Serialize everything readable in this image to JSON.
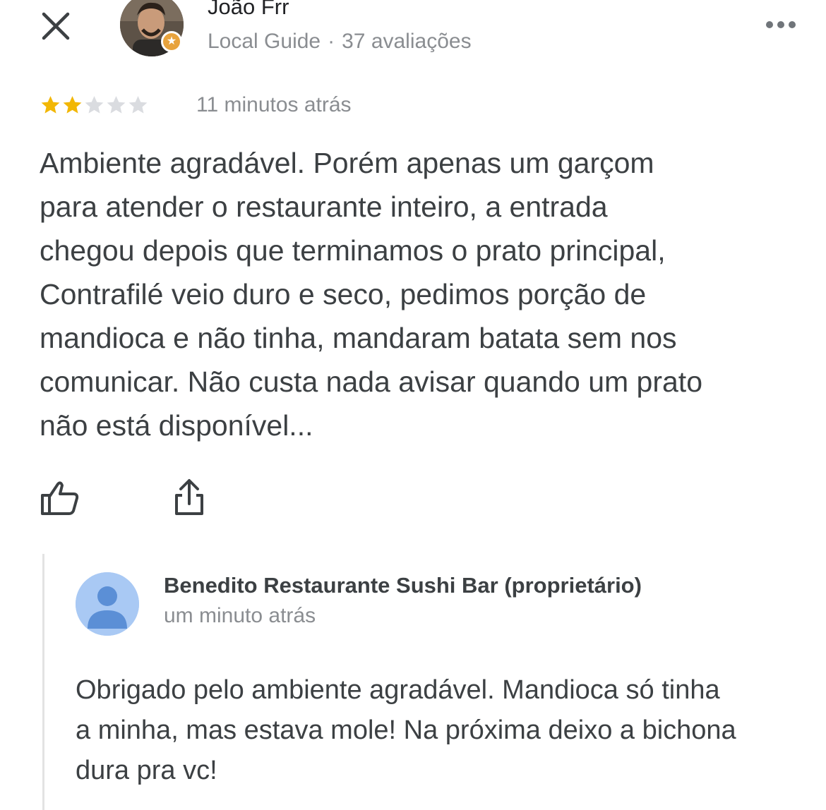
{
  "review": {
    "author": {
      "name": "João Frr",
      "badge": "Local Guide",
      "separator": "·",
      "review_count_label": "37 avaliações"
    },
    "rating": {
      "value": 2,
      "max": 5,
      "filled_color": "#f2b705",
      "empty_color": "#dadce0"
    },
    "time": "11 minutos atrás",
    "text_lines": [
      "Ambiente agradável. Porém apenas um garçom",
      "para atender o restaurante inteiro, a entrada",
      "chegou depois que terminamos o prato principal,",
      "Contrafilé veio duro e seco, pedimos porção de",
      "mandioca e não tinha, mandaram batata sem nos",
      "comunicar. Não custa nada avisar quando um prato",
      "não está disponível..."
    ]
  },
  "icons": {
    "close": "close-icon",
    "more": "more-horizontal-icon",
    "like": "thumbs-up-icon",
    "share": "share-icon",
    "owner_avatar": "person-icon"
  },
  "owner_reply": {
    "name": "Benedito Restaurante Sushi Bar (proprietário)",
    "time": "um minuto atrás",
    "text_lines": [
      "Obrigado pelo ambiente agradável. Mandioca só tinha",
      "a minha, mas estava mole! Na próxima deixo a bichona",
      "dura pra vc!"
    ]
  },
  "colors": {
    "text": "#3c4043",
    "secondary_text": "#8a8d91",
    "owner_avatar_bg": "#a9c9f4",
    "owner_avatar_fg": "#5b8fd6"
  }
}
